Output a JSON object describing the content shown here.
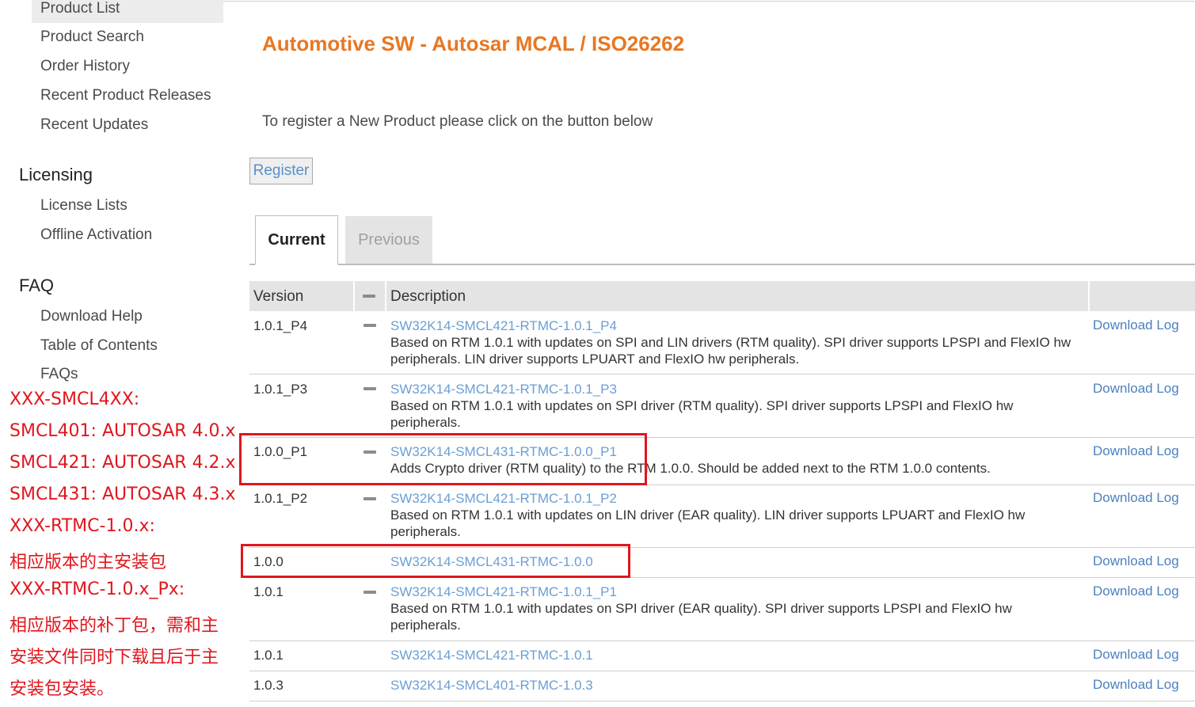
{
  "sidebar": {
    "items": [
      {
        "label": "Product List",
        "active": true
      },
      {
        "label": "Product Search"
      },
      {
        "label": "Order History"
      },
      {
        "label": "Recent Product Releases"
      },
      {
        "label": "Recent Updates"
      }
    ],
    "licensing": {
      "heading": "Licensing",
      "items": [
        {
          "label": "License Lists"
        },
        {
          "label": "Offline Activation"
        }
      ]
    },
    "faq": {
      "heading": "FAQ",
      "items": [
        {
          "label": "Download Help"
        },
        {
          "label": "Table of Contents"
        },
        {
          "label": "FAQs"
        }
      ]
    }
  },
  "annotation_lines": [
    "XXX-SMCL4XX:",
    "SMCL401: AUTOSAR 4.0.x",
    "SMCL421: AUTOSAR 4.2.x",
    "SMCL431: AUTOSAR 4.3.x",
    "XXX-RTMC-1.0.x:",
    "相应版本的主安装包",
    "XXX-RTMC-1.0.x_Px:",
    "相应版本的补丁包，需和主",
    "安装文件同时下载且后于主",
    "安装包安装。"
  ],
  "main": {
    "title": "Automotive SW - Autosar MCAL / ISO26262",
    "register_text": "To register a New Product please click on the button below",
    "register_button": "Register",
    "tabs": [
      {
        "label": "Current",
        "active": true
      },
      {
        "label": "Previous"
      }
    ],
    "table": {
      "headers": {
        "version": "Version",
        "description": "Description"
      },
      "download_log_label": "Download Log",
      "rows": [
        {
          "version": "1.0.1_P4",
          "product": "SW32K14-SMCL421-RTMC-1.0.1_P4",
          "description": "Based on RTM 1.0.1 with updates on SPI and LIN drivers (RTM quality). SPI driver supports LPSPI and FlexIO hw peripherals. LIN driver supports LPUART and FlexIO hw peripherals."
        },
        {
          "version": "1.0.1_P3",
          "product": "SW32K14-SMCL421-RTMC-1.0.1_P3",
          "description": "Based on RTM 1.0.1 with updates on SPI driver (RTM quality). SPI driver supports LPSPI and FlexIO hw peripherals."
        },
        {
          "version": "1.0.0_P1",
          "product": "SW32K14-SMCL431-RTMC-1.0.0_P1",
          "description": "Adds Crypto driver (RTM quality) to the RTM 1.0.0. Should be added next to the RTM 1.0.0 contents."
        },
        {
          "version": "1.0.1_P2",
          "product": "SW32K14-SMCL421-RTMC-1.0.1_P2",
          "description": "Based on RTM 1.0.1 with updates on LIN driver (EAR quality). LIN driver supports LPUART and FlexIO hw peripherals."
        },
        {
          "version": "1.0.0",
          "product": "SW32K14-SMCL431-RTMC-1.0.0",
          "description": ""
        },
        {
          "version": "1.0.1",
          "product": "SW32K14-SMCL421-RTMC-1.0.1_P1",
          "description": "Based on RTM 1.0.1 with updates on SPI driver (EAR quality). SPI driver supports LPSPI and FlexIO hw peripherals."
        },
        {
          "version": "1.0.1",
          "product": "SW32K14-SMCL421-RTMC-1.0.1",
          "description": ""
        },
        {
          "version": "1.0.3",
          "product": "SW32K14-SMCL401-RTMC-1.0.3",
          "description": ""
        }
      ]
    }
  },
  "colors": {
    "title": "#e87722",
    "link": "#6a9fd4",
    "annotation": "#e0161d"
  }
}
